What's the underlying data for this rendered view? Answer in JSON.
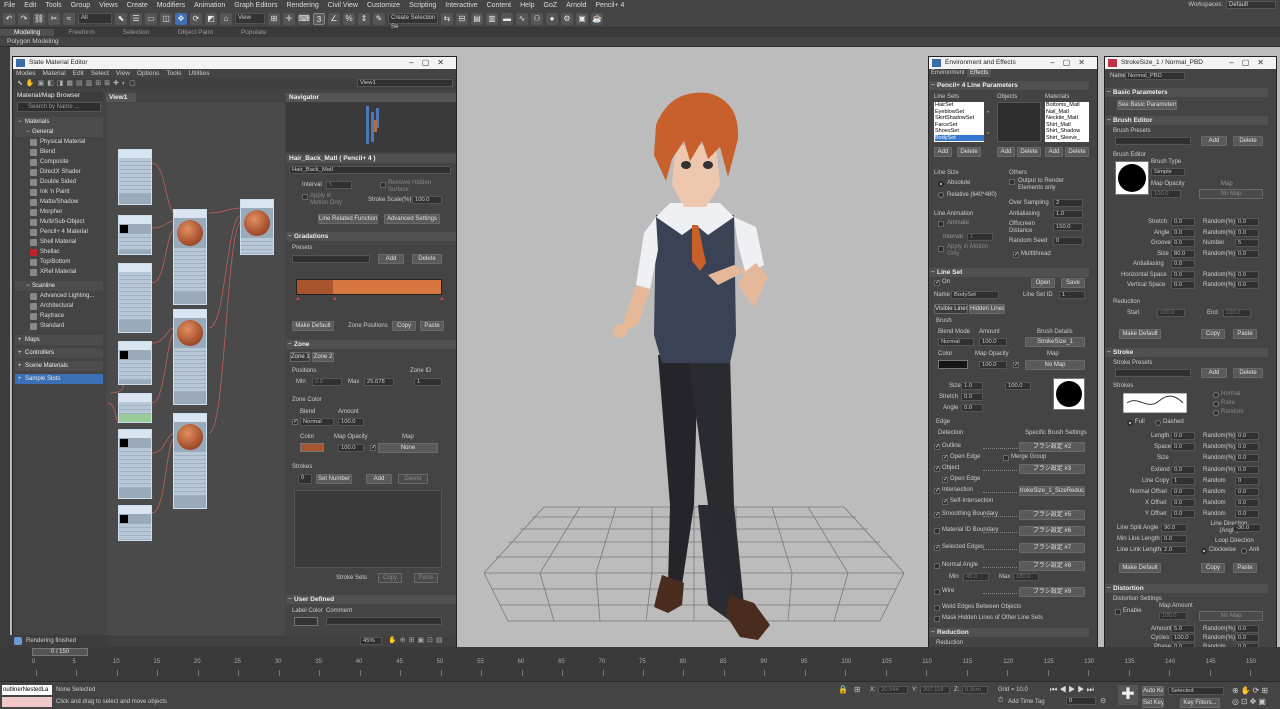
{
  "menu": [
    "File",
    "Edit",
    "Tools",
    "Group",
    "Views",
    "Create",
    "Modifiers",
    "Animation",
    "Graph Editors",
    "Rendering",
    "Civil View",
    "Customize",
    "Scripting",
    "Interactive",
    "Content",
    "Help",
    "GoZ",
    "Arnold",
    "Pencil+ 4"
  ],
  "workspaces": {
    "label": "Workspaces:",
    "value": "Default"
  },
  "toolbar": {
    "filter": "All",
    "coord": "View",
    "selection_set": "Create Selection Se"
  },
  "ribbon": {
    "tabs": [
      "Modeling",
      "Freeform",
      "Selection",
      "Object Paint",
      "Populate"
    ],
    "sub": "Polygon Modeling"
  },
  "sme": {
    "title": "Slate Material Editor",
    "menu": [
      "Modes",
      "Material",
      "Edit",
      "Select",
      "View",
      "Options",
      "Tools",
      "Utilities"
    ],
    "view_dropdown": "View1",
    "browser_title": "Material/Map Browser",
    "search": "Search by Name ...",
    "groups": {
      "materials": "Materials",
      "general": "General",
      "scanline": "Scanline",
      "maps": "Maps",
      "controllers": "Controllers",
      "scene_materials": "Scene Materials",
      "sample_slots": "Sample Slots"
    },
    "general_items": [
      "Physical Material",
      "Blend",
      "Composite",
      "DirectX Shader",
      "Double Sided",
      "Ink 'n Paint",
      "Matte/Shadow",
      "Morpher",
      "Multi/Sub-Object",
      "Pencil+ 4 Material",
      "Shell Material",
      "Shellac",
      "Top/Bottom",
      "XRef Material"
    ],
    "scanline_items": [
      "Advanced Lighting...",
      "Architectural",
      "Raytrace",
      "Standard"
    ],
    "view_tab": "View1",
    "navigator": "Navigator",
    "zoom": "45%",
    "props": {
      "header": "Hair_Back_Matl  ( Pencil+ 4 )",
      "name": "Hair_Back_Matl",
      "interval_label": "Interval",
      "interval_value": "5",
      "apply_motion": "Apply in Motion Only",
      "remove_hidden": "Remove Hidden Surface",
      "stroke_scale_label": "Stroke Scale(%)",
      "stroke_scale": "100.0",
      "line_related": "Line Related Functions",
      "advanced": "Advanced Settings",
      "gradations": "Gradations",
      "presets": "Presets",
      "add": "Add",
      "delete": "Delete",
      "make_default": "Make Default",
      "zone_positions": "Zone Positions",
      "copy": "Copy",
      "paste": "Paste",
      "zone": "Zone",
      "zone1": "Zone 1",
      "zone2": "Zone 2",
      "positions": "Positions",
      "min": "Min",
      "min_val": "0.0",
      "max": "Max",
      "max_val": "25.678",
      "zone_id": "Zone ID",
      "zone_id_val": "1",
      "zone_color": "Zone Color",
      "blend": "Blend",
      "blend_val": "Normal",
      "amount": "Amount",
      "amount_val": "100.0",
      "color": "Color",
      "map_opacity": "Map Opacity",
      "map_opacity_val": "100.0",
      "map": "Map",
      "map_val": "None",
      "strokes": "Strokes",
      "stroke_count": "0",
      "set_number": "Set Number",
      "stroke_sets": "Stroke Sets",
      "user_defined": "User Defined",
      "label_color": "Label Color",
      "comment": "Comment"
    }
  },
  "env": {
    "title": "Environment and Effects",
    "tabs": [
      "Environment",
      "Effects"
    ],
    "section": "Pencil+ 4 Line Parameters",
    "line_sets_label": "Line Sets",
    "objects_label": "Objects",
    "materials_label": "Materials",
    "line_sets": [
      "HairSet",
      "EyeblowSet",
      "SkirtShadowSet",
      "FarceSet",
      "ShoesSet",
      "BodySet"
    ],
    "materials": [
      "Bottoms_Matl",
      "Nail_Matl",
      "Necktie_Matl",
      "Shirt_Matl",
      "Shirt_Shadow",
      "Shirt_Sleeve_"
    ],
    "add": "Add",
    "delete": "Delete",
    "line_size": "Line Size",
    "absolute": "Absolute",
    "relative": "Relative (640*480)",
    "others": "Others",
    "output_elements": "Output to Render Elements only",
    "line_animation": "Line Animation",
    "animate": "Animate",
    "interval": "Interval",
    "interval_val": "1",
    "apply_motion": "Apply in Motion Only",
    "over_sampling": "Over Sampling",
    "over_sampling_val": "2",
    "antialiasing": "Antialiasing",
    "antialiasing_val": "1.0",
    "offscreen": "Offscreen Distance",
    "offscreen_val": "150.0",
    "random_seed": "Random Seed",
    "random_seed_val": "0",
    "multithread": "Multithread",
    "line_set": "Line Set",
    "on": "On",
    "open": "Open",
    "save": "Save",
    "name_label": "Name",
    "name_val": "BodySet",
    "line_set_id": "Line Set ID",
    "line_set_id_val": "1",
    "visible_lines": "Visible Lines",
    "hidden_lines": "Hidden Lines",
    "brush": "Brush",
    "blend_mode": "Blend Mode",
    "blend_val": "Normal",
    "amount": "Amount",
    "amount_val": "100.0",
    "brush_details": "Brush Details",
    "brush_details_val": "StrokeSize_1",
    "color": "Color",
    "map_opacity": "Map Opacity",
    "map_opacity_val": "100.0",
    "map": "Map",
    "no_map": "No Map",
    "size": "Size",
    "size_val": "1.0",
    "map_val": "100.0",
    "stretch": "Stretch",
    "stretch_val": "0.0",
    "angle": "Angle",
    "angle_val": "0.0",
    "edge": "Edge",
    "detection": "Detection",
    "specific_brush": "Specific Brush Settings",
    "outline": "Outline",
    "brush2": "ブラシ設定 #2",
    "open_edge": "Open Edge",
    "merge_group": "Merge Group",
    "object": "Object",
    "brush3": "ブラシ設定 #3",
    "intersection": "Intersection",
    "reduction_val": "trokeSize_1_SizeReductio",
    "self_intersection": "Self-Intersection",
    "smoothing": "Smoothing Boundary",
    "brush5": "ブラシ設定 #5",
    "material_id": "Material ID Boundary",
    "brush6": "ブラシ設定 #6",
    "selected_edges": "Selected Edges",
    "brush7": "ブラシ設定 #7",
    "normal_angle": "Normal Angle",
    "brush8": "ブラシ設定 #8",
    "min": "Min",
    "min_val": "45.0",
    "max": "Max",
    "max_val": "180.0",
    "wire": "Wire",
    "brush9": "ブラシ設定 #9",
    "weld": "Weld Edges Between Objects",
    "mask": "Mask Hidden Lines of Other Line Sets",
    "reduction": "Reduction",
    "reduction_sub": "Reduction"
  },
  "stroke": {
    "title": "StrokeSize_1 / Normal_PBD",
    "name_label": "Name",
    "name_val": "Normal_PBD",
    "basic": "Basic Parameters",
    "see_basic": "See Basic Parameters",
    "brush_editor": "Brush Editor",
    "brush_presets": "Brush Presets",
    "add": "Add",
    "delete": "Delete",
    "brush_editor2": "Brush Editor",
    "brush_type": "Brush Type",
    "brush_type_val": "Simple",
    "map_opacity": "Map Opacity",
    "map_opacity_val": "100.0",
    "map": "Map",
    "no_map": "No Map",
    "rows": [
      [
        "Stretch",
        "0.0",
        "Random(%)",
        "0.0"
      ],
      [
        "Angle",
        "0.0",
        "Random(%)",
        "0.0"
      ],
      [
        "Groove",
        "0.0",
        "Number",
        "5"
      ],
      [
        "Size",
        "80.0",
        "Random(%)",
        "0.0"
      ],
      [
        "Antialiasing",
        "0.0",
        "",
        ""
      ],
      [
        "Horizontal Space",
        "0.0",
        "Random(%)",
        "0.0"
      ],
      [
        "Vertical Space",
        "0.0",
        "Random(%)",
        "0.0"
      ]
    ],
    "reduction": "Reduction",
    "start": "Start",
    "start_val": "100.0",
    "end": "End",
    "end_val": "100.0",
    "make_default": "Make Default",
    "copy": "Copy",
    "paste": "Paste",
    "stroke_sec": "Stroke",
    "stroke_presets": "Stroke Presets",
    "strokes": "Strokes",
    "normal": "Normal",
    "rake": "Rake",
    "random": "Random",
    "full": "Full",
    "dashed": "Dashed",
    "srows": [
      [
        "Length",
        "0.0",
        "Random(%)",
        "0.0"
      ],
      [
        "Space",
        "0.0",
        "Random(%)",
        "0.0"
      ],
      [
        "Size",
        "",
        "Random(%)",
        "0.0"
      ],
      [
        "Extend",
        "0.0",
        "Random(%)",
        "0.0"
      ],
      [
        "Line Copy",
        "1",
        "Random",
        "0"
      ],
      [
        "Normal Offset",
        "0.0",
        "Random",
        "0.0"
      ],
      [
        "X Offset",
        "0.0",
        "Random",
        "0.0"
      ],
      [
        "Y Offset",
        "0.0",
        "Random",
        "0.0"
      ]
    ],
    "split_angle": "Line Split Angle",
    "split_val": "90.0",
    "line_direction": "Line Direction (Angle)",
    "dir_val": "-30.0",
    "min_length": "Min Line Length",
    "min_length_val": "0.0",
    "loop": "Loop Direction",
    "link_length": "Line Link Length",
    "link_val": "2.0",
    "clockwise": "Clockwise",
    "anti": "Anti",
    "distortion": "Distortion",
    "distortion_settings": "Distortion Settings",
    "enable": "Enable",
    "map_amount": "Map Amount",
    "map_amount_val": "100.0",
    "drows": [
      [
        "Amount",
        "5.0",
        "Random(%)",
        "0.0"
      ],
      [
        "Cycles",
        "100.0",
        "Random(%)",
        "0.0"
      ],
      [
        "Phase",
        "0.0",
        "Random",
        "0.0"
      ]
    ]
  },
  "timeline": {
    "range": "0 / 150",
    "ticks": [
      "0",
      "5",
      "10",
      "15",
      "20",
      "25",
      "30",
      "35",
      "40",
      "45",
      "50",
      "55",
      "60",
      "65",
      "70",
      "75",
      "80",
      "85",
      "90",
      "95",
      "100",
      "105",
      "110",
      "115",
      "120",
      "125",
      "130",
      "135",
      "140",
      "145",
      "150"
    ]
  },
  "status": {
    "rendering": "Rendering finished",
    "script": "outlinerNestedLa",
    "selection": "None Selected",
    "hint": "Click and drag to select and move objects",
    "x_label": "X:",
    "x": "20.944",
    "y_label": "Y:",
    "y": "207.118",
    "z_label": "Z:",
    "z": "0.0cm",
    "grid": "Grid = 10.0",
    "add_time_tag": "Add Time Tag",
    "auto_key": "Auto Key",
    "selected": "Selected",
    "set_key": "Set Key",
    "key_filters": "Key Filters...",
    "frame": "0"
  }
}
